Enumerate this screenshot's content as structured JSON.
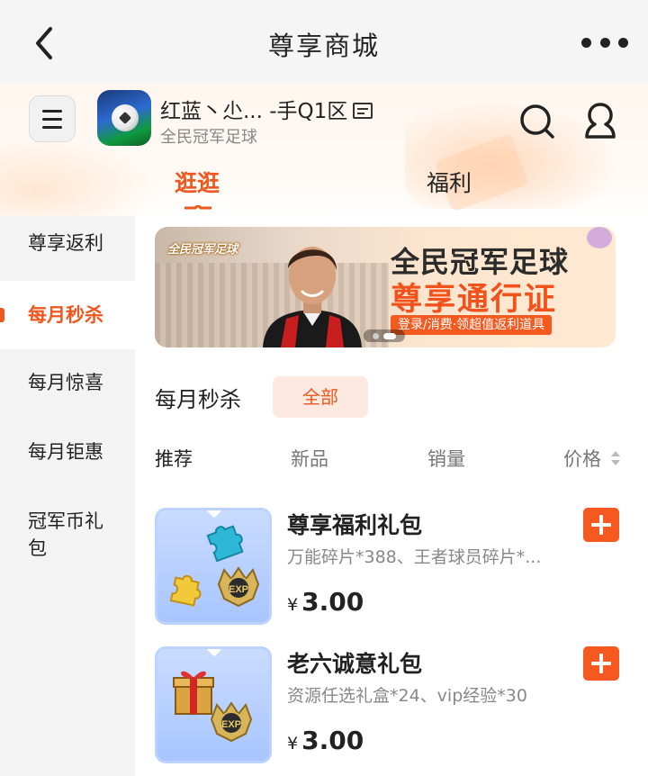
{
  "nav": {
    "title": "尊享商城"
  },
  "game": {
    "server": "红蓝丶尐...  -手Q1区",
    "name": "全民冠军足球"
  },
  "tabs": [
    {
      "label": "逛逛"
    },
    {
      "label": "福利"
    }
  ],
  "sidebar": {
    "items": [
      {
        "label": "尊享返利"
      },
      {
        "label": "每月秒杀"
      },
      {
        "label": "每月惊喜"
      },
      {
        "label": "每月钜惠"
      },
      {
        "label": "冠军币礼包"
      }
    ]
  },
  "banner": {
    "logo_text": "全民冠军足球",
    "title": "全民冠军足球",
    "subtitle": "尊享通行证",
    "tagline": "登录/消费·领超值返利道具"
  },
  "section": {
    "title": "每月秒杀",
    "filter_chip": "全部"
  },
  "sort": {
    "recommend": "推荐",
    "new": "新品",
    "sales": "销量",
    "price": "价格"
  },
  "products": [
    {
      "title": "尊享福利礼包",
      "desc": "万能碎片*388、王者球员碎片*...",
      "currency": "¥",
      "price": "3.00"
    },
    {
      "title": "老六诚意礼包",
      "desc": "资源任选礼盒*24、vip经验*30",
      "currency": "¥",
      "price": "3.00"
    }
  ],
  "colors": {
    "accent": "#f0571e",
    "add_button": "#f5591f",
    "chip_bg": "#fde9df"
  }
}
